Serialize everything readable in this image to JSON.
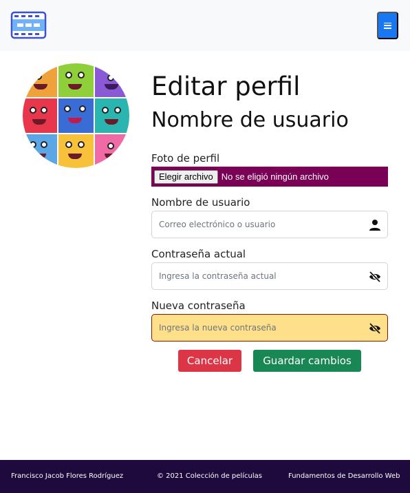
{
  "navbar": {
    "brand_icon": "film-strip-icon",
    "toggler_icon": "hamburger-menu-icon",
    "colors": {
      "background": "#f8f9fa",
      "toggler": "#1877f2",
      "brand": "#3b4fd8"
    }
  },
  "avatar": {
    "icon": "monster-collage-avatar"
  },
  "page": {
    "title": "Editar perfil",
    "subtitle": "Nombre de usuario"
  },
  "form": {
    "photo": {
      "label": "Foto de perfil",
      "button": "Elegir archivo",
      "status": "No se eligió ningún archivo"
    },
    "username": {
      "label": "Nombre de usuario",
      "placeholder": "Correo electrónico o usuario",
      "icon": "user-icon"
    },
    "current_password": {
      "label": "Contraseña actual",
      "placeholder": "Ingresa la contraseña actual",
      "icon": "eye-slash-icon"
    },
    "new_password": {
      "label": "Nueva contraseña",
      "placeholder": "Ingresa la nueva contraseña",
      "icon": "eye-slash-icon"
    },
    "cancel": "Cancelar",
    "save": "Guardar cambios"
  },
  "footer": {
    "author": "Francisco Jacob Flores Rodríguez",
    "copyright": "© 2021 Colección de películas",
    "course": "Fundamentos de Desarrollo Web"
  },
  "colors": {
    "cancel": "#dc3545",
    "save": "#198754",
    "file_bar": "#7a0055",
    "warning_field": "#ffe08a",
    "footer": "#1e0a3c"
  }
}
